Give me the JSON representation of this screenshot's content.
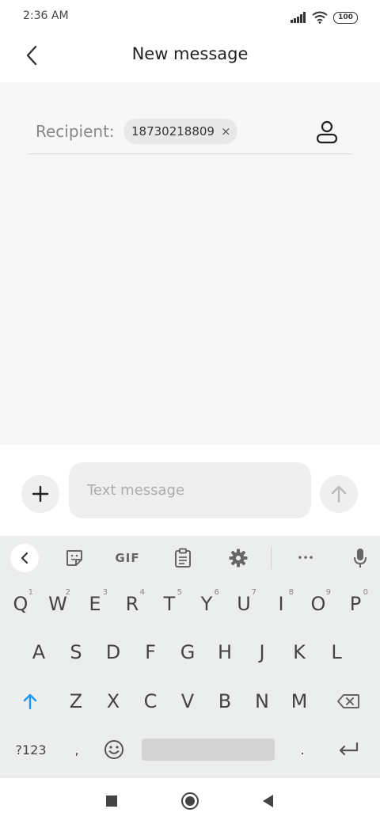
{
  "status_bar": {
    "time": "2:36 AM",
    "battery": "100"
  },
  "app_bar": {
    "title": "New message"
  },
  "recipient": {
    "label": "Recipient:",
    "chip_number": "18730218809",
    "chip_remove": "×"
  },
  "compose": {
    "placeholder": "Text message"
  },
  "keyboard": {
    "toolbar": {
      "gif_label": "GIF",
      "more_label": "•••"
    },
    "row1": [
      {
        "k": "Q",
        "h": "1"
      },
      {
        "k": "W",
        "h": "2"
      },
      {
        "k": "E",
        "h": "3"
      },
      {
        "k": "R",
        "h": "4"
      },
      {
        "k": "T",
        "h": "5"
      },
      {
        "k": "Y",
        "h": "6"
      },
      {
        "k": "U",
        "h": "7"
      },
      {
        "k": "I",
        "h": "8"
      },
      {
        "k": "O",
        "h": "9"
      },
      {
        "k": "P",
        "h": "0"
      }
    ],
    "row2": [
      "A",
      "S",
      "D",
      "F",
      "G",
      "H",
      "J",
      "K",
      "L"
    ],
    "row3": [
      "Z",
      "X",
      "C",
      "V",
      "B",
      "N",
      "M"
    ],
    "row4": {
      "symbols": "?123",
      "comma": ",",
      "period": "."
    }
  },
  "colors": {
    "accent": "#2196F3",
    "surface": "#f7f7f7",
    "keyboard_bg": "#eceded"
  }
}
